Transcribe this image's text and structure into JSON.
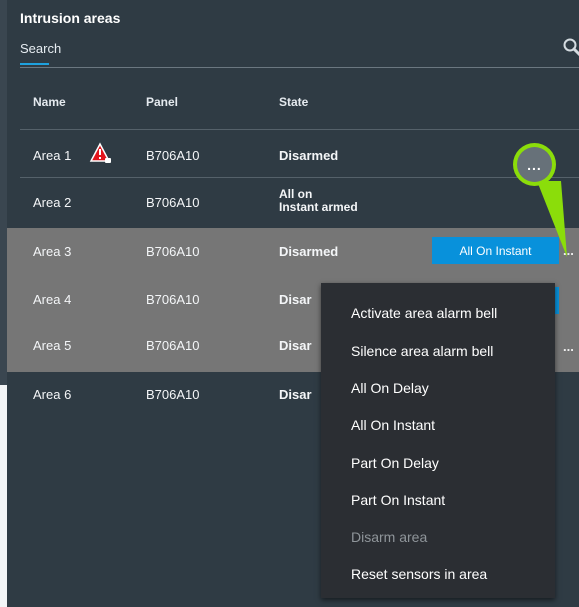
{
  "panel": {
    "title": "Intrusion areas",
    "search_placeholder": "Search"
  },
  "table": {
    "headers": [
      "Name",
      "Panel",
      "State"
    ],
    "rows": [
      {
        "name": "Area 1",
        "panel": "B706A10",
        "state": "Disarmed",
        "warning": true
      },
      {
        "name": "Area 2",
        "panel": "B706A10",
        "state_line1": "All on",
        "state_line2": "Instant armed"
      },
      {
        "name": "Area 3",
        "panel": "B706A10",
        "state": "Disarmed"
      },
      {
        "name": "Area 4",
        "panel": "B706A10",
        "state": "Disar"
      },
      {
        "name": "Area 5",
        "panel": "B706A10",
        "state": "Disar"
      },
      {
        "name": "Area 6",
        "panel": "B706A10",
        "state": "Disar"
      }
    ]
  },
  "actions": {
    "inline_button": "All On Instant",
    "callout_label": "...",
    "row_ellipsis": "..."
  },
  "menu": {
    "items": [
      {
        "label": "Activate area alarm bell",
        "disabled": false
      },
      {
        "label": "Silence area alarm bell",
        "disabled": false
      },
      {
        "label": "All On Delay",
        "disabled": false
      },
      {
        "label": "All On Instant",
        "disabled": false
      },
      {
        "label": "Part On Delay",
        "disabled": false
      },
      {
        "label": "Part On Instant",
        "disabled": false
      },
      {
        "label": "Disarm area",
        "disabled": true
      },
      {
        "label": "Reset sensors in area",
        "disabled": false
      }
    ]
  },
  "colors": {
    "background": "#2f3b44",
    "highlight_row": "#767676",
    "accent_blue": "#0891db",
    "callout_green": "#8bdd0a",
    "menu_background": "#2b2e33",
    "disabled_text": "#8f959a"
  },
  "icons": {
    "search": "search-icon",
    "warning": "warning-icon"
  }
}
